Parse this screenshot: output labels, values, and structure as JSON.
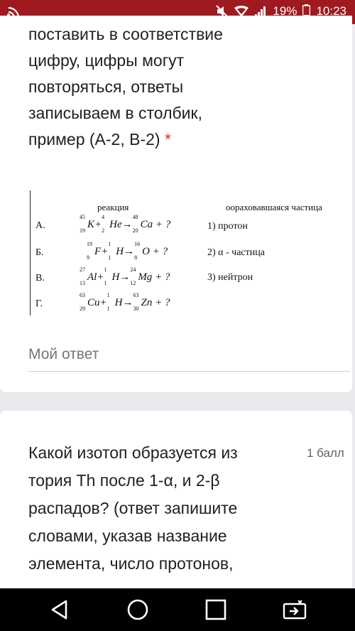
{
  "status_bar": {
    "battery_percent": "19%",
    "time": "10:23",
    "icons": [
      "cast-icon",
      "mute-icon",
      "wifi-icon",
      "signal-icon",
      "battery-icon"
    ]
  },
  "question1": {
    "text_lines": [
      "поставить в соответствие",
      "цифру, цифры могут",
      "повторяться, ответы",
      "записываем в столбик,",
      "пример (А-2, В-2)"
    ],
    "required_mark": "*",
    "table": {
      "header_reaction": "реакция",
      "header_particle": "оораховавшаяся частица",
      "rows": [
        {
          "letter": "А.",
          "reaction": "K + He → Ca + ?",
          "particle": "1) протон"
        },
        {
          "letter": "Б.",
          "reaction": "F + H → O + ?",
          "particle": "2) α - частица"
        },
        {
          "letter": "В.",
          "reaction": "Al + H → Mg + ?",
          "particle": "3) нейтрон"
        },
        {
          "letter": "Г.",
          "reaction": "Cu + H → Zn + ?",
          "particle": ""
        }
      ]
    },
    "answer_placeholder": "Мой ответ"
  },
  "question2": {
    "text_lines": [
      "Какой изотоп образуется из",
      "тория Th после 1-α, и 2-β",
      "распадов? (ответ запишите",
      "словами, указав название",
      "элемента, число протонов,"
    ],
    "points": "1 балл"
  },
  "nav_bar": {
    "icons": [
      "back-icon",
      "home-icon",
      "recents-icon",
      "screen-share-icon"
    ]
  }
}
